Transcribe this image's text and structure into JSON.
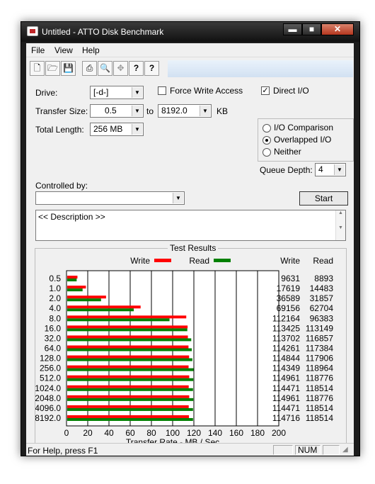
{
  "window": {
    "title": "Untitled - ATTO Disk Benchmark",
    "controls": [
      "▬",
      "■",
      "✕"
    ]
  },
  "menu": [
    "File",
    "View",
    "Help"
  ],
  "toolbar": {
    "icons": [
      "new-file-icon",
      "open-folder-icon",
      "save-icon",
      "print-icon",
      "print-preview-icon",
      "move-icon",
      "help-icon",
      "context-help-icon"
    ],
    "glyphs": [
      "🗋",
      "🗁",
      "💾",
      "⎙",
      "🔍",
      "✥",
      "?",
      "?"
    ]
  },
  "settings": {
    "drive_label": "Drive:",
    "drive_value": "[-d-]",
    "force_write_label": "Force Write Access",
    "force_write_checked": false,
    "direct_io_label": "Direct I/O",
    "direct_io_checked": true,
    "transfer_size_label": "Transfer Size:",
    "transfer_from": "0.5",
    "transfer_to_label": "to",
    "transfer_to": "8192.0",
    "transfer_unit": "KB",
    "total_length_label": "Total Length:",
    "total_length": "256 MB",
    "io_options": [
      {
        "label": "I/O Comparison",
        "selected": false
      },
      {
        "label": "Overlapped I/O",
        "selected": true
      },
      {
        "label": "Neither",
        "selected": false
      }
    ],
    "queue_depth_label": "Queue Depth:",
    "queue_depth": "4",
    "controlled_by_label": "Controlled by:",
    "controlled_by_value": "",
    "start_label": "Start",
    "description": "<< Description >>"
  },
  "results": {
    "title": "Test Results",
    "legend_write": "Write",
    "legend_read": "Read",
    "col_write": "Write",
    "col_read": "Read",
    "write_color": "#ff0000",
    "read_color": "#008000"
  },
  "chart_data": {
    "type": "bar",
    "orientation": "horizontal",
    "title": "Test Results",
    "xlabel": "Transfer Rate - MB / Sec",
    "ylabel": "",
    "xlim": [
      0,
      200
    ],
    "xticks": [
      0,
      20,
      40,
      60,
      80,
      100,
      120,
      140,
      160,
      180,
      200
    ],
    "grid": true,
    "legend_position": "top",
    "categories": [
      "0.5",
      "1.0",
      "2.0",
      "4.0",
      "8.0",
      "16.0",
      "32.0",
      "64.0",
      "128.0",
      "256.0",
      "512.0",
      "1024.0",
      "2048.0",
      "4096.0",
      "8192.0"
    ],
    "series": [
      {
        "name": "Write",
        "values": [
          9631,
          17619,
          36589,
          69156,
          112164,
          113425,
          113702,
          114261,
          114844,
          114349,
          114961,
          114471,
          114961,
          114471,
          114716
        ]
      },
      {
        "name": "Read",
        "values": [
          8893,
          14483,
          31857,
          62704,
          96383,
          113149,
          116857,
          117384,
          117906,
          118964,
          118776,
          118514,
          118776,
          118514,
          118514
        ]
      }
    ]
  },
  "statusbar": {
    "help": "For Help, press F1",
    "num": "NUM"
  }
}
